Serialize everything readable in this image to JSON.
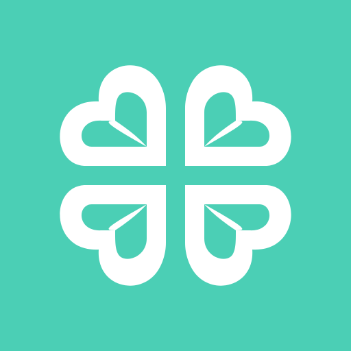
{
  "app_icon": {
    "name": "clover-logo",
    "icon": "four-leaf-clover-icon",
    "colors": {
      "background": "#4bcfb5",
      "foreground": "#ffffff"
    }
  }
}
